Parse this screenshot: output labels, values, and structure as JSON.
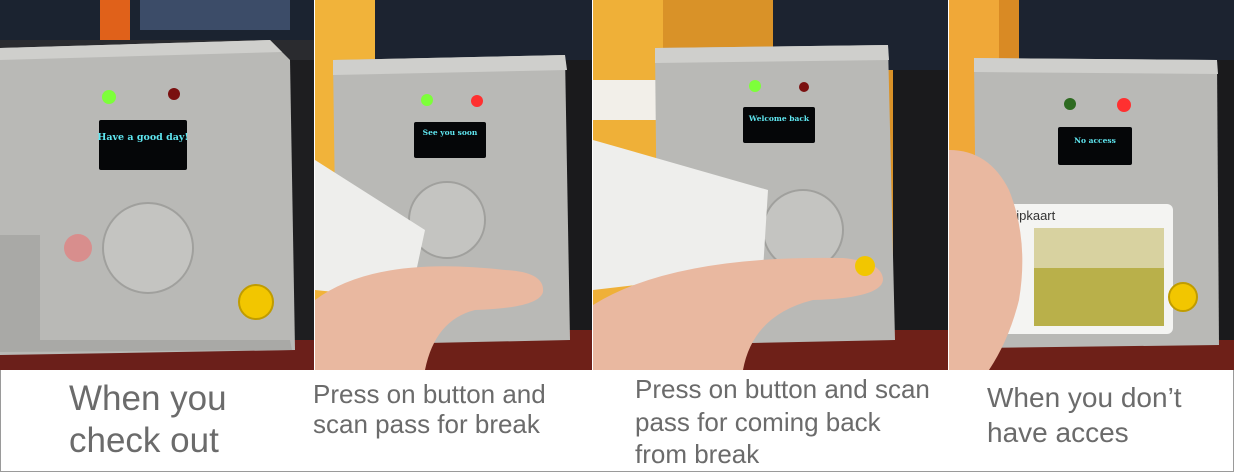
{
  "panels": [
    {
      "screen_text": "Have a good day!",
      "green_led": "on",
      "red_led": "off",
      "caption": "When you check out"
    },
    {
      "screen_text": "See you soon",
      "green_led": "on",
      "red_led": "on",
      "caption": "Press on button and scan pass for break"
    },
    {
      "screen_text": "Welcome back",
      "green_led": "on",
      "red_led": "off",
      "caption": "Press on button and scan pass for coming back from break"
    },
    {
      "screen_text": "No access",
      "green_led": "off",
      "red_led": "on",
      "caption": "When you don’t have acces",
      "card_label": "hipkaart"
    }
  ],
  "colors": {
    "case": "#b9b9b6",
    "case_dark": "#8f8f8c",
    "oled_bg": "#050608",
    "oled_text": "#5fe6f0",
    "led_green": "#7dff3a",
    "led_red": "#ff3030",
    "button_yellow": "#f2c600",
    "caption_text": "#6b6b6b"
  }
}
